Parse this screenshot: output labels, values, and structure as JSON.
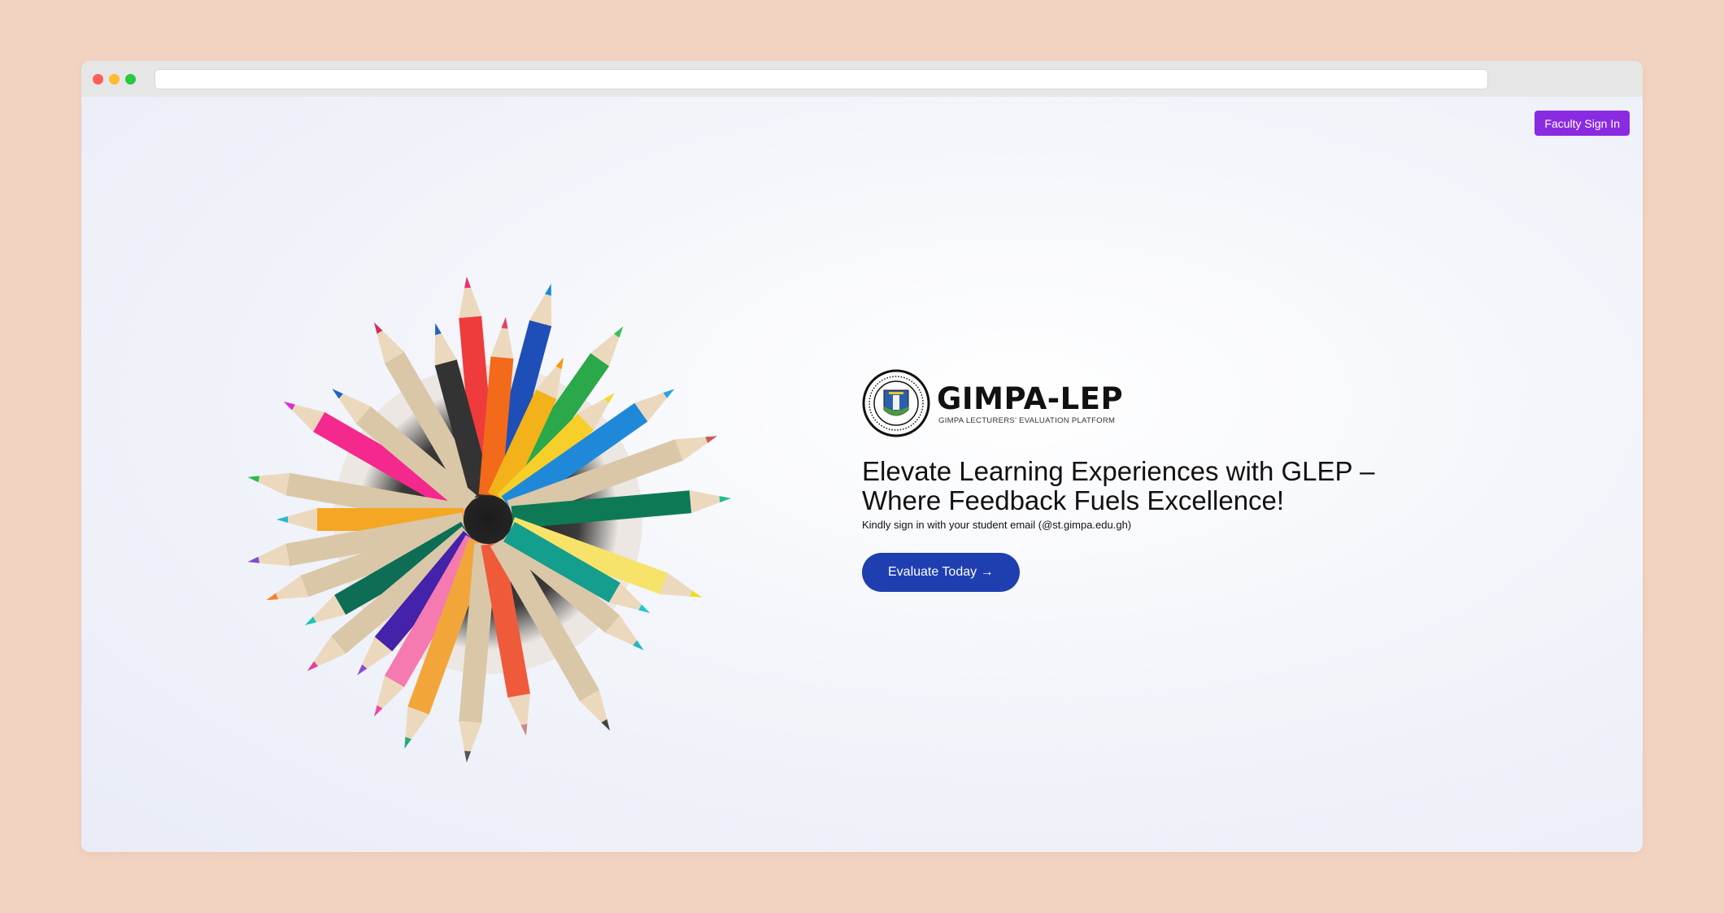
{
  "header": {
    "faculty_sign_in_label": "Faculty Sign In"
  },
  "logo": {
    "title": "GIMPA-LEP",
    "subtitle": "GIMPA LECTURERS' EVALUATION PLATFORM"
  },
  "hero": {
    "headline": "Elevate Learning Experiences with GLEP – Where Feedback Fuels Excellence!",
    "instruction": "Kindly sign in with your student email (@st.gimpa.edu.gh)",
    "cta_label": "Evaluate Today →"
  },
  "colors": {
    "page_background": "#f2d3c1",
    "faculty_button": "#8a2be2",
    "cta_button": "#1f3fb0"
  },
  "icons": [
    "gimpa-seal-icon",
    "colored-pencils-image"
  ]
}
